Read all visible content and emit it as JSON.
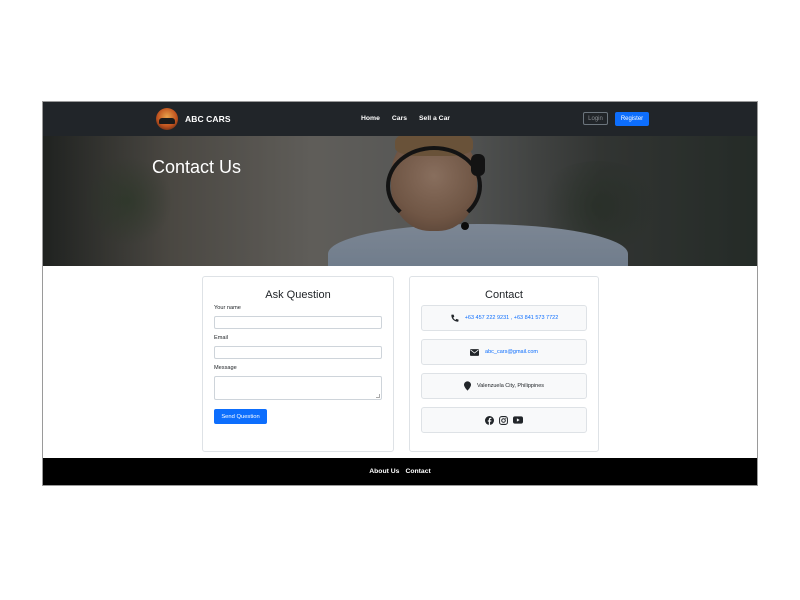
{
  "navbar": {
    "brand": "ABC CARS",
    "links": [
      "Home",
      "Cars",
      "Sell a Car"
    ],
    "login_label": "Login",
    "register_label": "Register"
  },
  "hero": {
    "title": "Contact Us"
  },
  "ask_form": {
    "title": "Ask Question",
    "name_label": "Your name",
    "name_value": "",
    "email_label": "Email",
    "email_value": "",
    "message_label": "Message",
    "message_value": "",
    "submit_label": "Send Question"
  },
  "contact": {
    "title": "Contact",
    "phone": "+63 457 222 9231 , +63 841 573 7722",
    "email": "abc_cars@gmail.com",
    "address": "Valenzuela City, Philippines",
    "social_icons": [
      "facebook-icon",
      "instagram-icon",
      "youtube-icon"
    ]
  },
  "footer": {
    "links": [
      "About Us",
      "Contact"
    ]
  },
  "colors": {
    "navbar_bg": "#212529",
    "primary": "#0d6efd",
    "footer_bg": "#000000"
  }
}
